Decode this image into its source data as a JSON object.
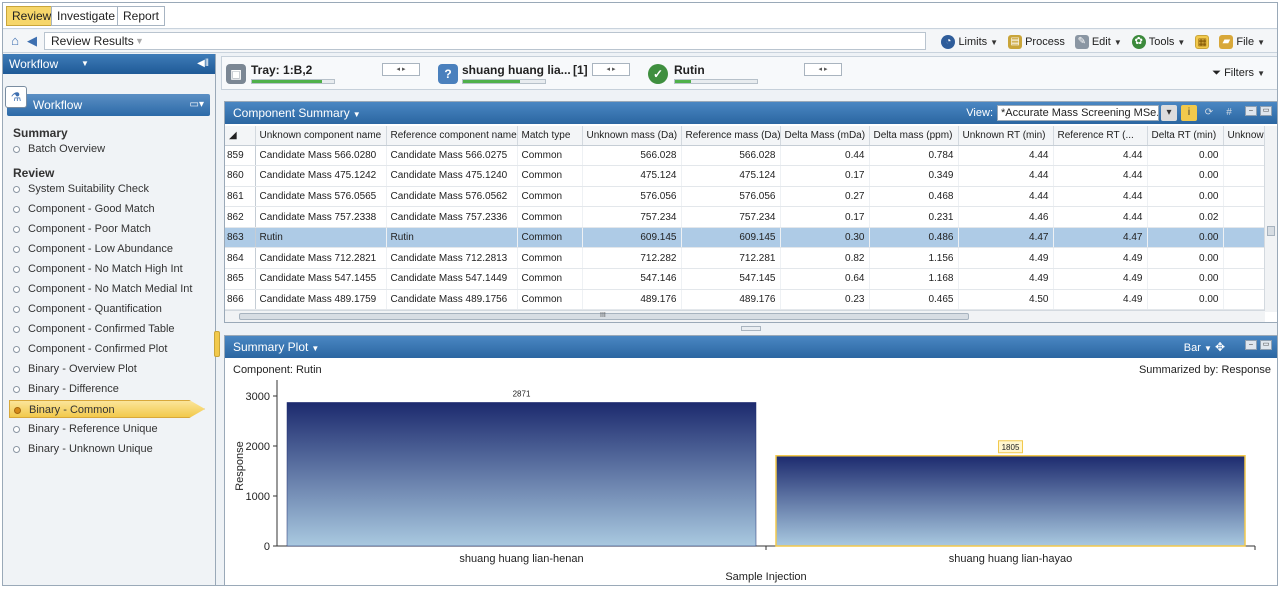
{
  "tabs": [
    "Review",
    "Investigate",
    "Report"
  ],
  "breadcrumb": "Review Results",
  "toolbar": {
    "limits": "Limits",
    "process": "Process",
    "edit": "Edit",
    "tools": "Tools",
    "file": "File"
  },
  "sidebar": {
    "header": "Workflow",
    "panel_title": "Workflow",
    "summary_heading": "Summary",
    "summary_items": [
      "Batch Overview"
    ],
    "review_heading": "Review",
    "review_items": [
      "System Suitability Check",
      "Component - Good Match",
      "Component - Poor Match",
      "Component - Low Abundance",
      "Component - No Match High Int",
      "Component - No Match Medial Int",
      "Component - Quantification",
      "Component - Confirmed Table",
      "Component - Confirmed Plot",
      "Binary - Overview Plot",
      "Binary - Difference",
      "Binary - Common",
      "Binary -  Reference Unique",
      "Binary - Unknown Unique"
    ],
    "active_item": "Binary - Common"
  },
  "status_strip": {
    "tray": "Tray: 1:B,2",
    "tray_progress": 0.85,
    "sample": "shuang huang lia...",
    "sample_index": "[1]",
    "sample_progress": 0.7,
    "component": "Rutin",
    "component_progress": 0.2,
    "filters": "Filters"
  },
  "component_summary": {
    "title": "Component Summary",
    "view_label": "View:",
    "view_value": "*Accurate Mass Screening MSe...",
    "scroll_mark": "III",
    "columns": [
      "Unknown component name",
      "Reference component name",
      "Match type",
      "Unknown mass (Da)",
      "Reference mass (Da)",
      "Delta Mass (mDa)",
      "Delta mass (ppm)",
      "Unknown RT (min)",
      "Reference RT (...",
      "Delta RT (min)",
      "Unknow"
    ],
    "rows": [
      {
        "n": "859",
        "cells": [
          "Candidate Mass 566.0280",
          "Candidate Mass 566.0275",
          "Common",
          "566.028",
          "566.028",
          "0.44",
          "0.784",
          "4.44",
          "4.44",
          "0.00",
          ""
        ]
      },
      {
        "n": "860",
        "cells": [
          "Candidate Mass 475.1242",
          "Candidate Mass 475.1240",
          "Common",
          "475.124",
          "475.124",
          "0.17",
          "0.349",
          "4.44",
          "4.44",
          "0.00",
          ""
        ]
      },
      {
        "n": "861",
        "cells": [
          "Candidate Mass 576.0565",
          "Candidate Mass 576.0562",
          "Common",
          "576.056",
          "576.056",
          "0.27",
          "0.468",
          "4.44",
          "4.44",
          "0.00",
          ""
        ]
      },
      {
        "n": "862",
        "cells": [
          "Candidate Mass 757.2338",
          "Candidate Mass 757.2336",
          "Common",
          "757.234",
          "757.234",
          "0.17",
          "0.231",
          "4.46",
          "4.44",
          "0.02",
          ""
        ]
      },
      {
        "n": "863",
        "cells": [
          "Rutin",
          "Rutin",
          "Common",
          "609.145",
          "609.145",
          "0.30",
          "0.486",
          "4.47",
          "4.47",
          "0.00",
          ""
        ]
      },
      {
        "n": "864",
        "cells": [
          "Candidate Mass 712.2821",
          "Candidate Mass 712.2813",
          "Common",
          "712.282",
          "712.281",
          "0.82",
          "1.156",
          "4.49",
          "4.49",
          "0.00",
          ""
        ]
      },
      {
        "n": "865",
        "cells": [
          "Candidate Mass 547.1455",
          "Candidate Mass 547.1449",
          "Common",
          "547.146",
          "547.145",
          "0.64",
          "1.168",
          "4.49",
          "4.49",
          "0.00",
          ""
        ]
      },
      {
        "n": "866",
        "cells": [
          "Candidate Mass 489.1759",
          "Candidate Mass 489.1756",
          "Common",
          "489.176",
          "489.176",
          "0.23",
          "0.465",
          "4.50",
          "4.49",
          "0.00",
          ""
        ]
      }
    ],
    "selected_row": "863"
  },
  "summary_plot": {
    "title": "Summary Plot",
    "chart_kind_label": "Bar",
    "component_label": "Component: Rutin",
    "summarized_by": "Summarized by: Response"
  },
  "chart_data": {
    "type": "bar",
    "categories": [
      "shuang huang lian-henan",
      "shuang huang lian-hayao"
    ],
    "values": [
      2871,
      1805
    ],
    "data_labels": [
      "2871",
      "1805"
    ],
    "xlabel": "Sample Injection",
    "ylabel": "Response",
    "ylim": [
      0,
      3200
    ],
    "yticks": [
      0,
      1000,
      2000,
      3000
    ],
    "colors": {
      "bar_top": "#1c2a6e",
      "bar_bottom": "#a9c9e0",
      "highlight_border": "#f2c94c"
    }
  }
}
